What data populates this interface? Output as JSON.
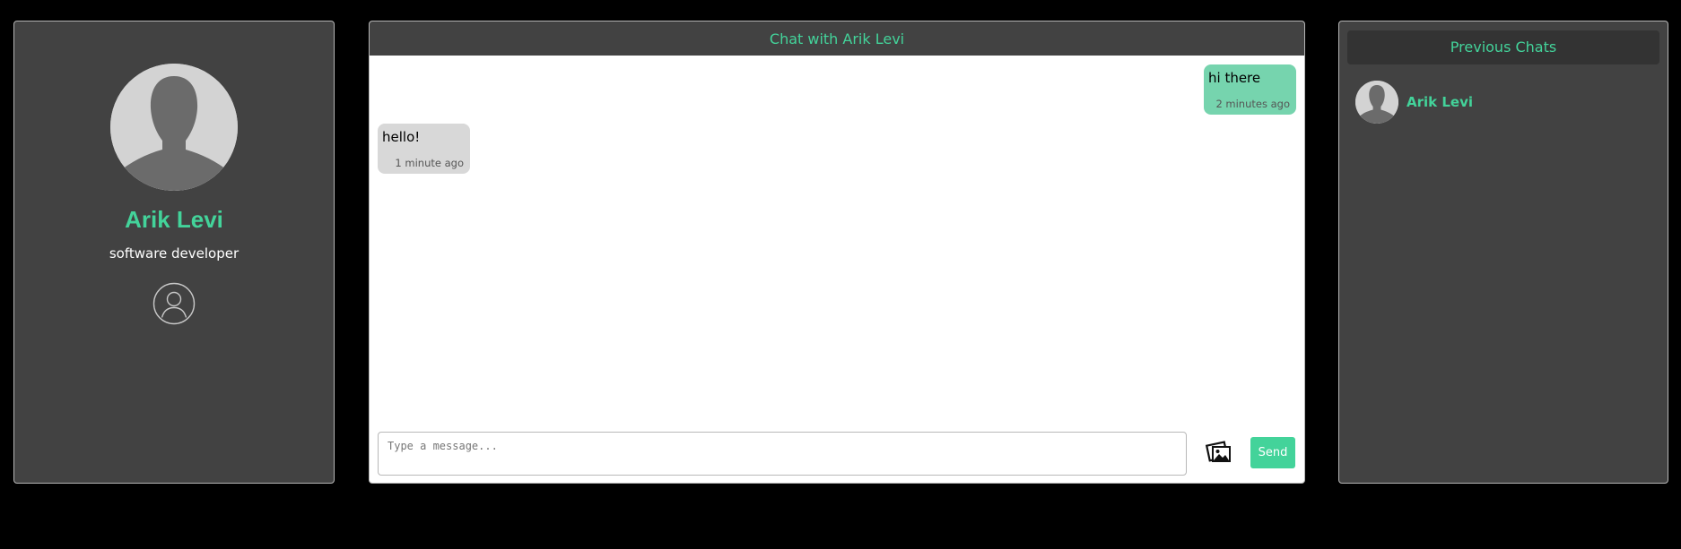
{
  "profile": {
    "avatar_icon": "default-avatar-silhouette",
    "name": "Arik Levi",
    "role": "software developer",
    "user_icon": "user-circle-outline-icon"
  },
  "chat": {
    "title": "Chat with Arik Levi",
    "messages": [
      {
        "direction": "sent",
        "text": "hi there",
        "time": "2 minutes ago"
      },
      {
        "direction": "received",
        "text": "hello!",
        "time": "1 minute ago"
      }
    ],
    "composer": {
      "placeholder": "Type a message...",
      "value": "",
      "attach_icon": "image-gallery-icon",
      "send_label": "Send"
    }
  },
  "history": {
    "title": "Previous Chats",
    "items": [
      {
        "name": "Arik Levi",
        "avatar_icon": "default-avatar-silhouette"
      }
    ]
  },
  "colors": {
    "page_background": "#000000",
    "panel_background": "#424242",
    "accent_green": "#43d39a",
    "sent_bubble": "#76d4ae",
    "received_bubble": "#d8d8d8"
  }
}
